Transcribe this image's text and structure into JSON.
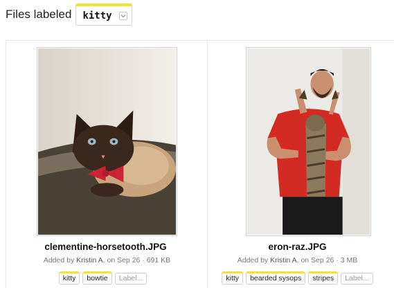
{
  "header": {
    "prefix": "Files labeled",
    "selected_label": "kitty"
  },
  "colors": {
    "tag_accent": "#f5e132"
  },
  "files": [
    {
      "name": "clementine-horsetooth.JPG",
      "added_prefix": "Added by",
      "author": "Kristin A.",
      "date_text": "on Sep 26",
      "size": "691 KB",
      "tags": [
        "kitty",
        "bowtie"
      ],
      "add_label": "Label...",
      "image_icon": "cat-photo"
    },
    {
      "name": "eron-raz.JPG",
      "added_prefix": "Added by",
      "author": "Kristin A.",
      "date_text": "on Sep 26",
      "size": "3 MB",
      "tags": [
        "kitty",
        "bearded sysops",
        "stripes"
      ],
      "add_label": "Label...",
      "image_icon": "man-holding-cat-photo"
    }
  ]
}
